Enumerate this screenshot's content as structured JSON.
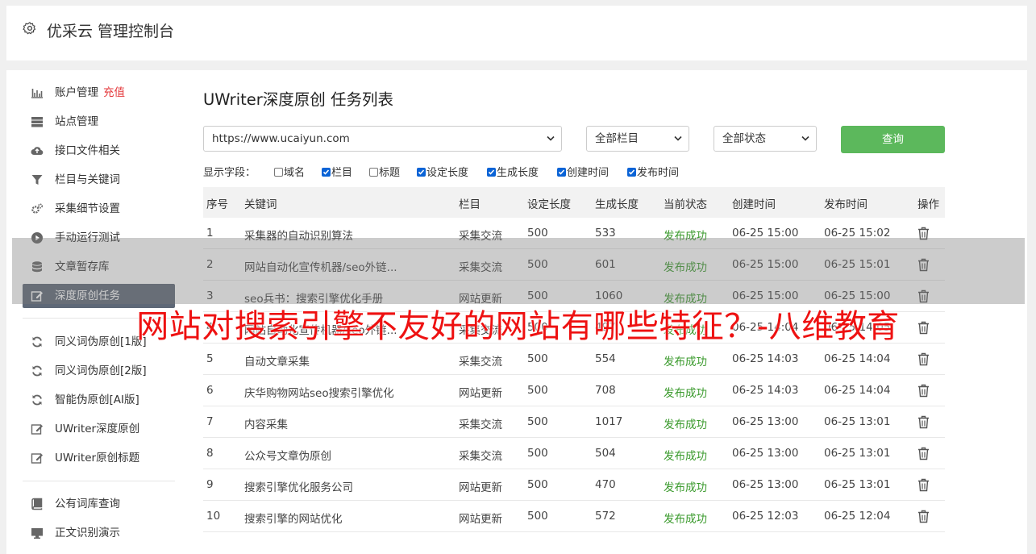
{
  "header": {
    "title": "优采云 管理控制台",
    "icon": "gear-icon"
  },
  "sidebar": {
    "items": [
      {
        "label": "账户管理",
        "extra": "充值",
        "icon": "bar-chart-icon"
      },
      {
        "label": "站点管理",
        "icon": "server-icon"
      },
      {
        "label": "接口文件相关",
        "icon": "cloud-upload-icon"
      },
      {
        "label": "栏目与关键词",
        "icon": "filter-icon"
      },
      {
        "label": "采集细节设置",
        "icon": "gears-icon"
      },
      {
        "label": "手动运行测试",
        "icon": "play-circle-icon"
      },
      {
        "label": "文章暂存库",
        "icon": "database-icon"
      },
      {
        "label": "深度原创任务",
        "icon": "edit-icon",
        "active": true
      },
      {
        "label": "同义词伪原创[1版]",
        "icon": "refresh-icon"
      },
      {
        "label": "同义词伪原创[2版]",
        "icon": "refresh-icon"
      },
      {
        "label": "智能伪原创[AI版]",
        "icon": "refresh-icon"
      },
      {
        "label": "UWriter深度原创",
        "icon": "edit-icon"
      },
      {
        "label": "UWriter原创标题",
        "icon": "edit-icon"
      },
      {
        "label": "公有词库查询",
        "icon": "book-icon"
      },
      {
        "label": "正文识别演示",
        "icon": "desktop-icon"
      }
    ]
  },
  "main": {
    "title": "UWriter深度原创 任务列表",
    "filters": {
      "site": "https://www.ucaiyun.com",
      "column": "全部栏目",
      "status": "全部状态",
      "query_label": "查询"
    },
    "fields": {
      "label": "显示字段：",
      "options": [
        {
          "label": "域名",
          "checked": false
        },
        {
          "label": "栏目",
          "checked": true
        },
        {
          "label": "标题",
          "checked": false
        },
        {
          "label": "设定长度",
          "checked": true
        },
        {
          "label": "生成长度",
          "checked": true
        },
        {
          "label": "创建时间",
          "checked": true
        },
        {
          "label": "发布时间",
          "checked": true
        }
      ]
    },
    "table": {
      "columns": [
        "序号",
        "关键词",
        "栏目",
        "设定长度",
        "生成长度",
        "当前状态",
        "创建时间",
        "发布时间",
        "操作"
      ],
      "rows": [
        [
          "1",
          "采集器的自动识别算法",
          "采集交流",
          "500",
          "533",
          "发布成功",
          "06-25 15:00",
          "06-25 15:02"
        ],
        [
          "2",
          "网站自动化宣传机器/seo外链...",
          "采集交流",
          "500",
          "601",
          "发布成功",
          "06-25 15:00",
          "06-25 15:01"
        ],
        [
          "3",
          "seo兵书：搜索引擎优化手册",
          "网站更新",
          "500",
          "1060",
          "发布成功",
          "06-25 15:00",
          "06-25 15:00"
        ],
        [
          "4",
          "网站自动化宣传机器/seo外链...",
          "采集交流",
          "500",
          "497",
          "发布成功",
          "06-25 14:04",
          "06-25 14:05"
        ],
        [
          "5",
          "自动文章采集",
          "采集交流",
          "500",
          "554",
          "发布成功",
          "06-25 14:03",
          "06-25 14:04"
        ],
        [
          "6",
          "庆华购物网站seo搜索引擎优化",
          "网站更新",
          "500",
          "708",
          "发布成功",
          "06-25 14:03",
          "06-25 14:04"
        ],
        [
          "7",
          "内容采集",
          "采集交流",
          "500",
          "1017",
          "发布成功",
          "06-25 13:00",
          "06-25 13:01"
        ],
        [
          "8",
          "公众号文章伪原创",
          "采集交流",
          "500",
          "504",
          "发布成功",
          "06-25 13:00",
          "06-25 13:01"
        ],
        [
          "9",
          "搜索引擎优化服务公司",
          "网站更新",
          "500",
          "470",
          "发布成功",
          "06-25 13:00",
          "06-25 13:01"
        ],
        [
          "10",
          "搜索引擎的网站优化",
          "网站更新",
          "500",
          "572",
          "发布成功",
          "06-25 12:03",
          "06-25 12:04"
        ]
      ]
    }
  },
  "overlay": {
    "text": "网站对搜索引擎不友好的网站有哪些特征？-八维教育"
  },
  "colors": {
    "accent": "#5cb85c",
    "status": "#3a9a2c",
    "overlay": "#ee1111",
    "active_bg": "#5e6877"
  }
}
